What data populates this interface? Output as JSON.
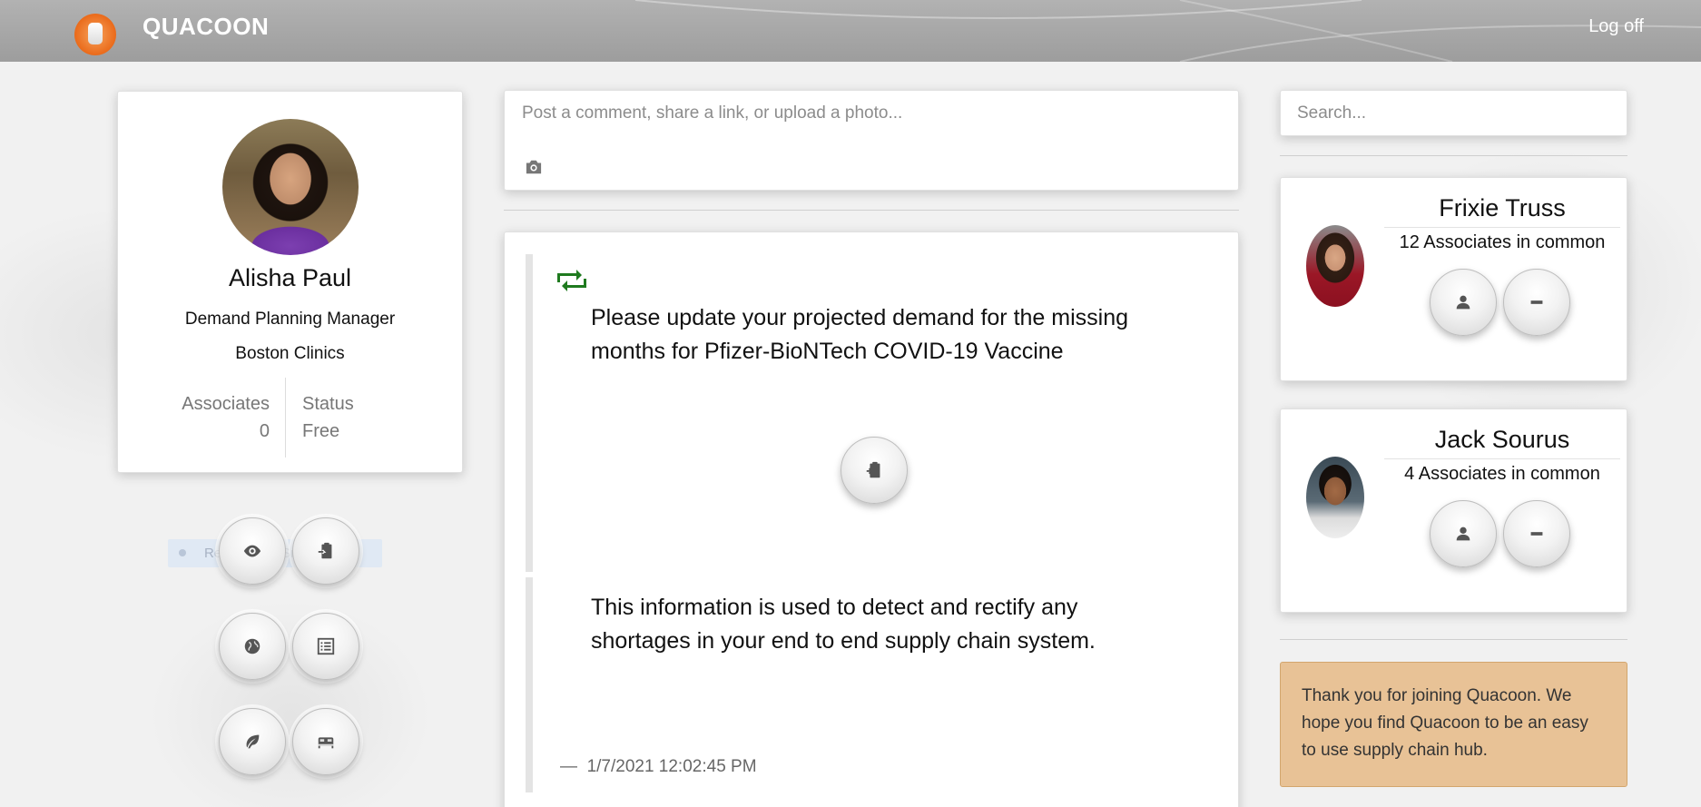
{
  "header": {
    "brand": "QUACOON",
    "logoff_label": "Log off"
  },
  "profile": {
    "name": "Alisha Paul",
    "title": "Demand Planning Manager",
    "organization": "Boston Clinics",
    "associates_label": "Associates",
    "associates_value": "0",
    "status_label": "Status",
    "status_value": "Free"
  },
  "side_buttons": [
    {
      "icon": "eye-icon"
    },
    {
      "icon": "clipboard-icon"
    },
    {
      "icon": "globe-icon"
    },
    {
      "icon": "list-icon"
    },
    {
      "icon": "leaf-icon"
    },
    {
      "icon": "bed-icon"
    }
  ],
  "ghost_label": "Rectangular Snip",
  "composer": {
    "placeholder": "Post a comment, share a link, or upload a photo..."
  },
  "post": {
    "message": "Please update your projected demand for the missing months for Pfizer-BioNTech COVID-19 Vaccine",
    "info": "This information is used to detect and rectify any shortages in your end to end supply chain system.",
    "date_dash": "—",
    "date": "1/7/2021 12:02:45 PM"
  },
  "search": {
    "placeholder": "Search..."
  },
  "suggestions": [
    {
      "name": "Frixie Truss",
      "common": "12 Associates in common"
    },
    {
      "name": "Jack Sourus",
      "common": "4 Associates in common"
    }
  ],
  "notice": {
    "text": "Thank you for joining Quacoon. We hope you find Quacoon to be an easy to use supply chain hub."
  },
  "colors": {
    "accent_orange": "#ea6a1a",
    "repost_green": "#1f7a1f",
    "notice_bg": "#e8c296"
  }
}
